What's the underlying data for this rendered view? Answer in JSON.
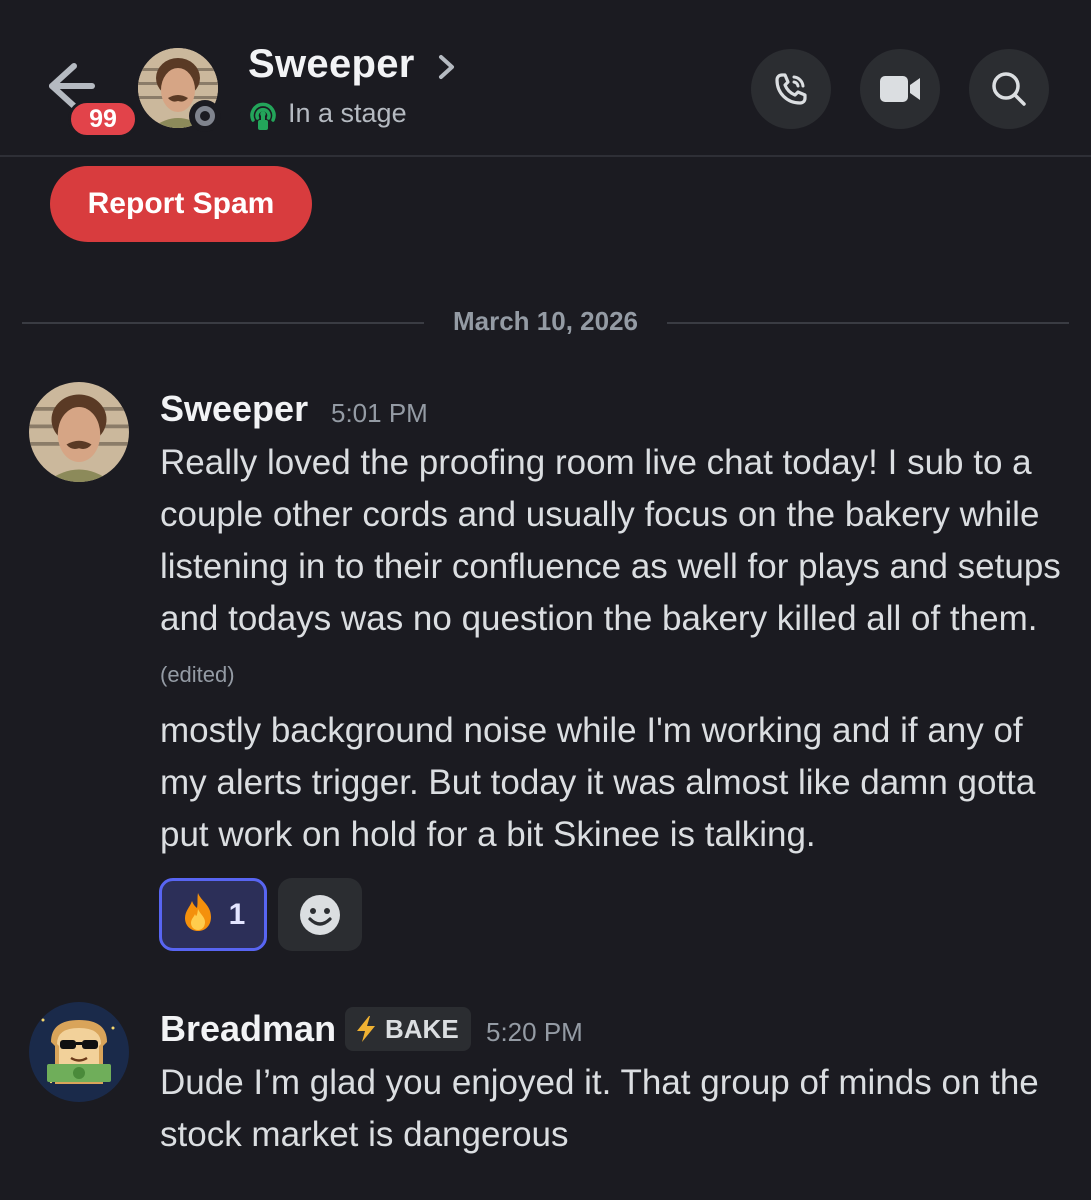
{
  "header": {
    "unread_count": "99",
    "name": "Sweeper",
    "status": "In a stage"
  },
  "report_spam": {
    "label": "Report Spam"
  },
  "divider": {
    "date": "March 10, 2026"
  },
  "messages": [
    {
      "author": "Sweeper",
      "time": "5:01 PM",
      "paragraphs": [
        "Really loved the proofing room live chat today! I sub to a couple other cords and usually focus on the bakery while listening in to their confluence as well for plays and setups and todays was no question the bakery killed all of them.",
        "mostly background noise while I'm working and if any of my alerts trigger. But today it was almost like damn gotta put work on hold for a bit Skinee is talking."
      ],
      "edited_label": "(edited)",
      "reactions": [
        {
          "emoji": "🔥",
          "icon": "fire-emoji",
          "count": "1"
        }
      ]
    },
    {
      "author": "Breadman",
      "role": {
        "icon": "lightning-icon",
        "label": "BAKE"
      },
      "time": "5:20 PM",
      "paragraphs": [
        "Dude I’m glad you enjoyed it. That group of minds on the stock market is dangerous"
      ]
    }
  ],
  "colors": {
    "background": "#1b1b21",
    "report_red": "#d83c3e",
    "badge_red": "#e2434a",
    "reaction_blurple": "#5865f2",
    "stage_green": "#23a55a"
  }
}
